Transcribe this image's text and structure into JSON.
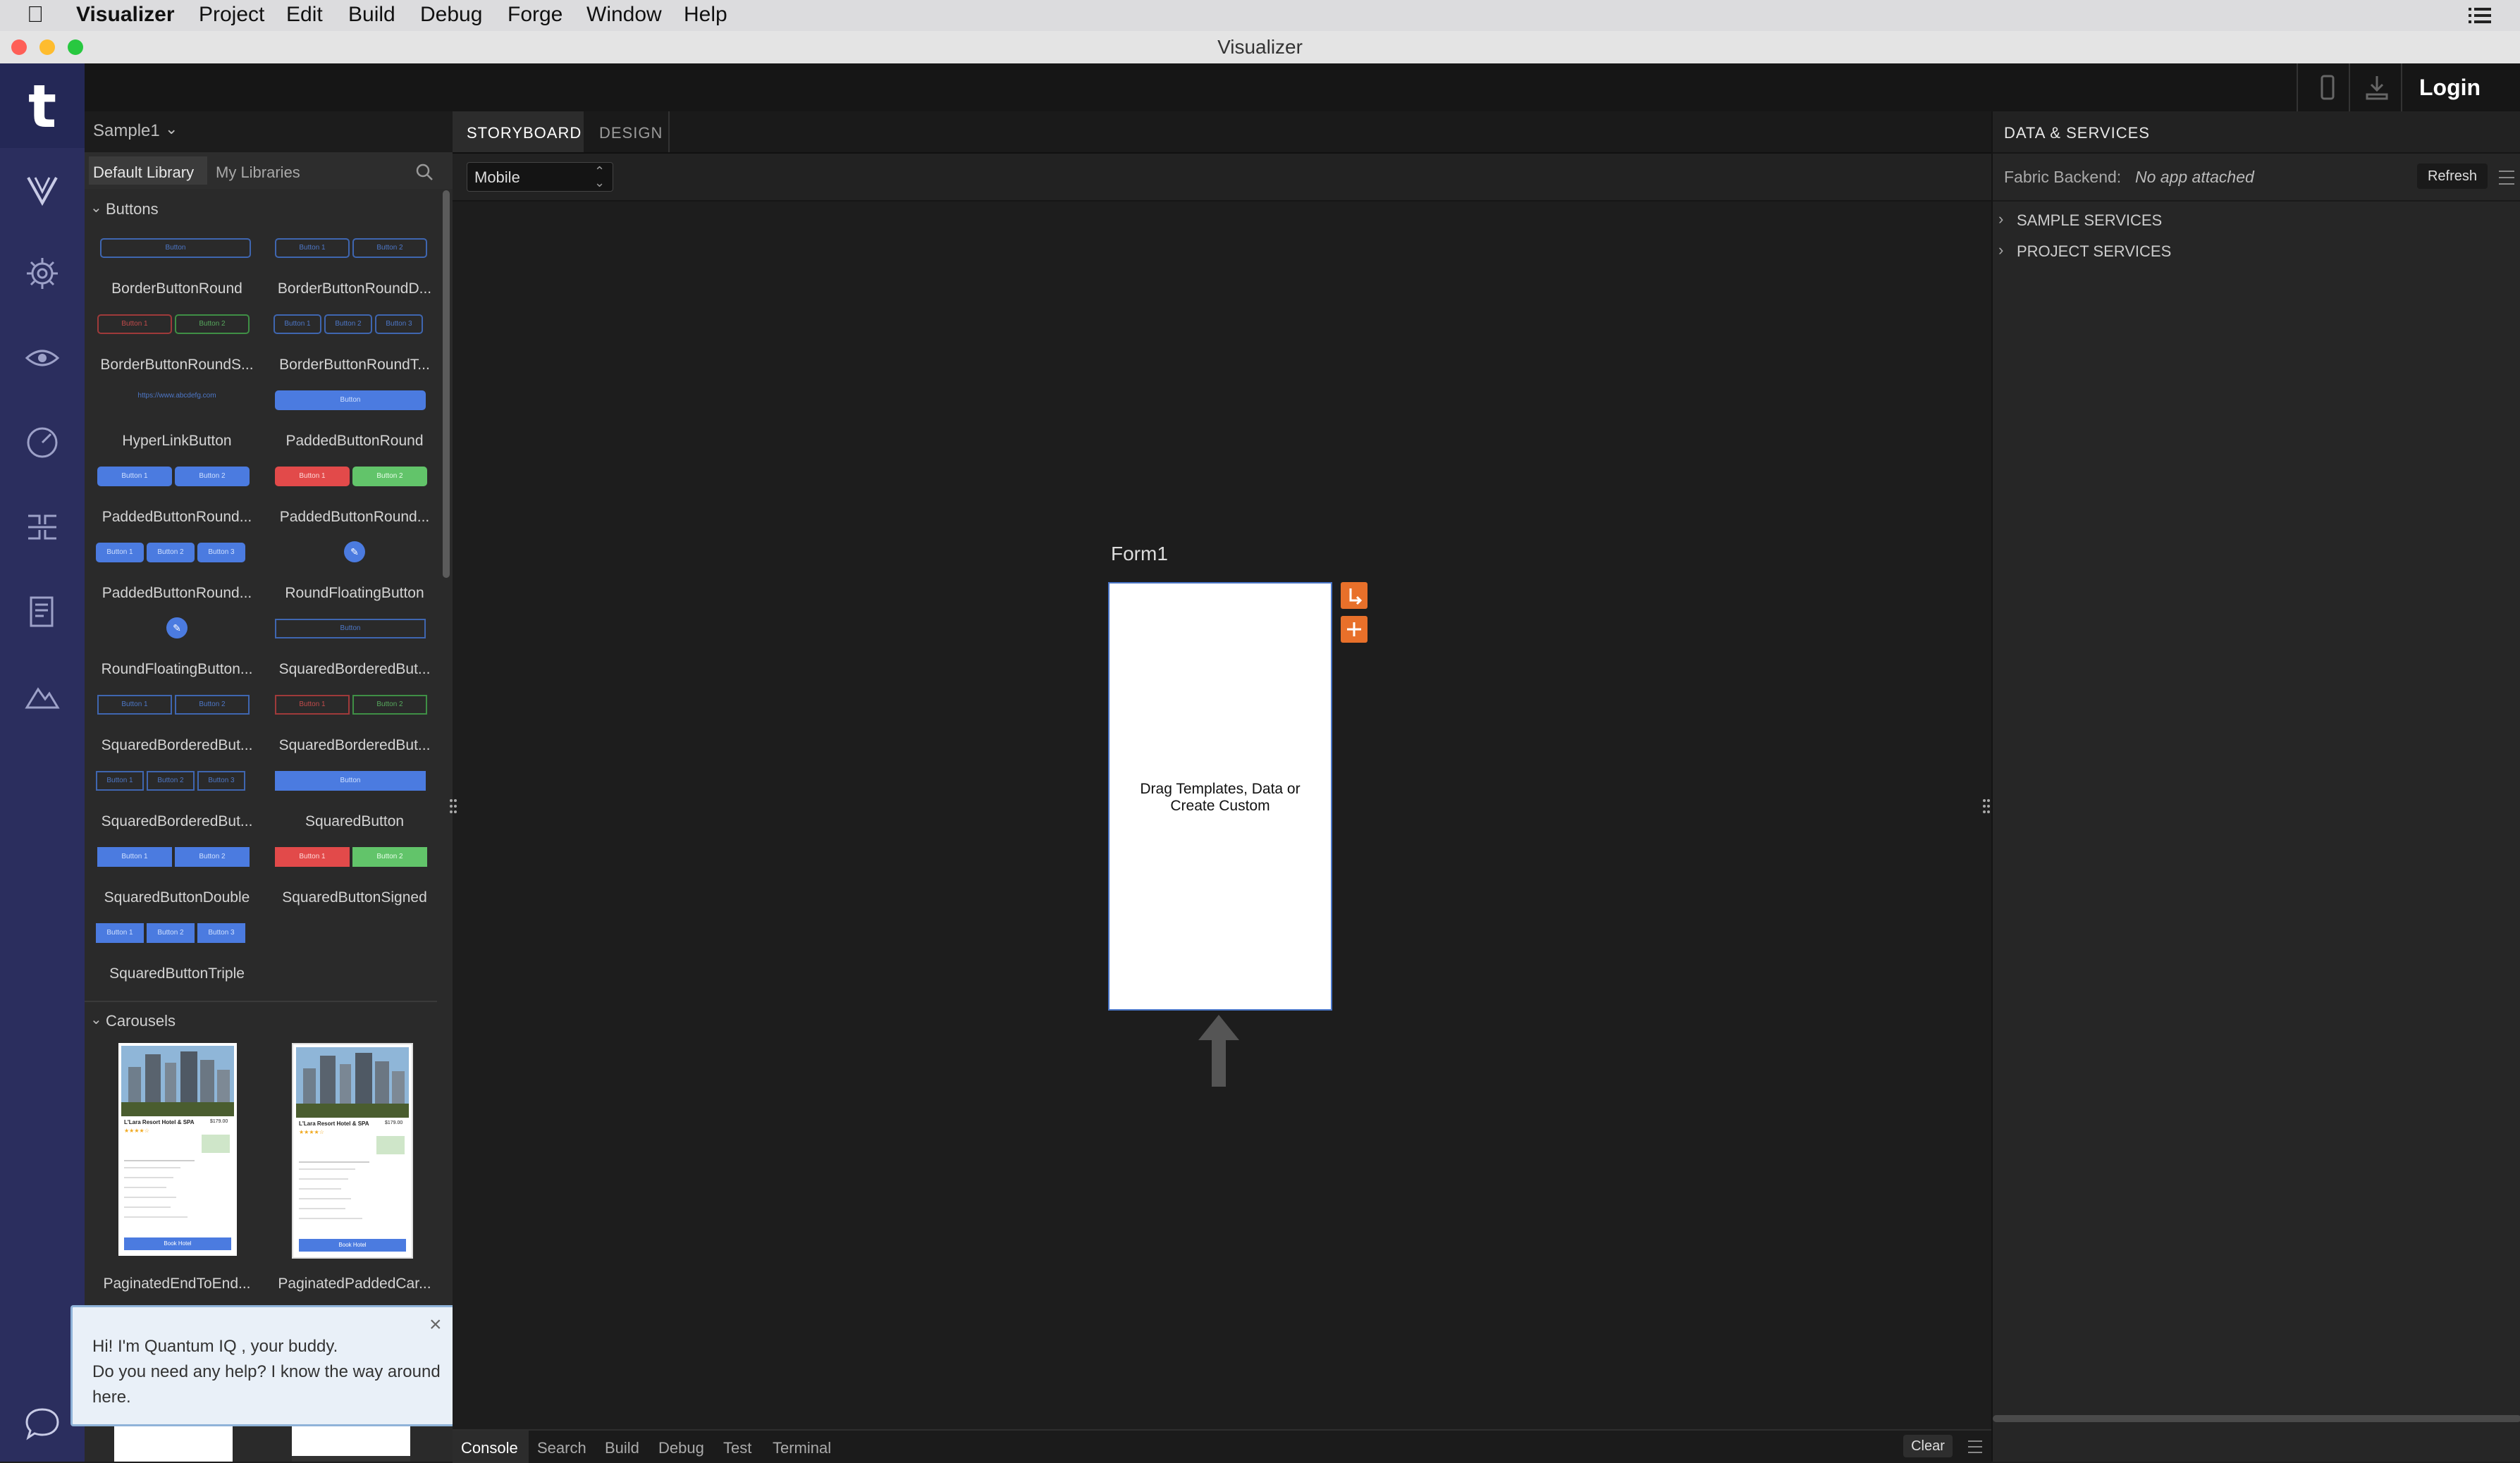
{
  "menubar": {
    "app_name": "Visualizer",
    "items": [
      "Project",
      "Edit",
      "Build",
      "Debug",
      "Forge",
      "Window",
      "Help"
    ]
  },
  "window": {
    "title": "Visualizer"
  },
  "topbar": {
    "login_label": "Login"
  },
  "project": {
    "name": "Sample1"
  },
  "library": {
    "tabs": [
      "Default Library",
      "My Libraries"
    ],
    "sections": {
      "buttons": "Buttons",
      "carousels": "Carousels"
    },
    "button_tiles": [
      "BorderButtonRound",
      "BorderButtonRoundD...",
      "BorderButtonRoundS...",
      "BorderButtonRoundT...",
      "HyperLinkButton",
      "PaddedButtonRound",
      "PaddedButtonRound...",
      "PaddedButtonRound...",
      "PaddedButtonRound...",
      "RoundFloatingButton",
      "RoundFloatingButton...",
      "SquaredBorderedBut...",
      "SquaredBorderedBut...",
      "SquaredBorderedBut...",
      "SquaredBorderedBut...",
      "SquaredButton",
      "SquaredButtonDouble",
      "SquaredButtonSigned",
      "SquaredButtonTriple"
    ],
    "carousel_tiles": [
      "PaginatedEndToEnd...",
      "PaginatedPaddedCar..."
    ],
    "mini": {
      "button": "Button",
      "b1": "Button 1",
      "b2": "Button 2",
      "b3": "Button 3",
      "link": "https://www.abcdefg.com",
      "hotel": "L'Lara Resort Hotel & SPA",
      "price": "$179.00",
      "book": "Book Hotel"
    }
  },
  "canvas": {
    "tabs": [
      "STORYBOARD",
      "DESIGN"
    ],
    "device": "Mobile",
    "form_name": "Form1",
    "placeholder": "Drag Templates, Data or Create Custom"
  },
  "assistant": {
    "line1": "Hi! I'm Quantum IQ , your buddy.",
    "line2": "Do you need any help? I know the way around here."
  },
  "console": {
    "tabs": [
      "Console",
      "Search",
      "Build",
      "Debug",
      "Test",
      "Terminal"
    ],
    "clear_label": "Clear"
  },
  "data_services": {
    "title": "DATA & SERVICES",
    "backend_label": "Fabric Backend:",
    "backend_value": "No app attached",
    "refresh_label": "Refresh",
    "groups": [
      "SAMPLE SERVICES",
      "PROJECT SERVICES"
    ]
  },
  "colors": {
    "rail": "#2b2e5e",
    "accent_orange": "#e8702a",
    "button_blue": "#4b7be0"
  }
}
